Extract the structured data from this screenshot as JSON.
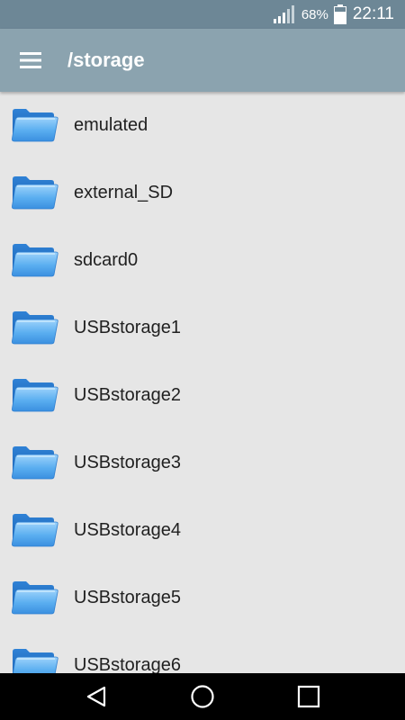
{
  "status_bar": {
    "battery_percent": "68%",
    "time": "22:11",
    "signal_icon": "signal-icon",
    "battery_icon": "battery-icon"
  },
  "app_bar": {
    "menu_icon": "menu-icon",
    "title": "/storage"
  },
  "folders": [
    {
      "name": "emulated",
      "icon": "folder-icon"
    },
    {
      "name": "external_SD",
      "icon": "folder-icon"
    },
    {
      "name": "sdcard0",
      "icon": "folder-icon"
    },
    {
      "name": "USBstorage1",
      "icon": "folder-icon"
    },
    {
      "name": "USBstorage2",
      "icon": "folder-icon"
    },
    {
      "name": "USBstorage3",
      "icon": "folder-icon"
    },
    {
      "name": "USBstorage4",
      "icon": "folder-icon"
    },
    {
      "name": "USBstorage5",
      "icon": "folder-icon"
    },
    {
      "name": "USBstorage6",
      "icon": "folder-icon"
    }
  ],
  "nav_bar": {
    "back_icon": "back-icon",
    "home_icon": "home-icon",
    "recents_icon": "recents-icon"
  },
  "colors": {
    "status_bar": "#6d8796",
    "app_bar": "#8ba3af",
    "list_background": "#e6e6e6",
    "folder_blue": "#4aa3ec"
  }
}
